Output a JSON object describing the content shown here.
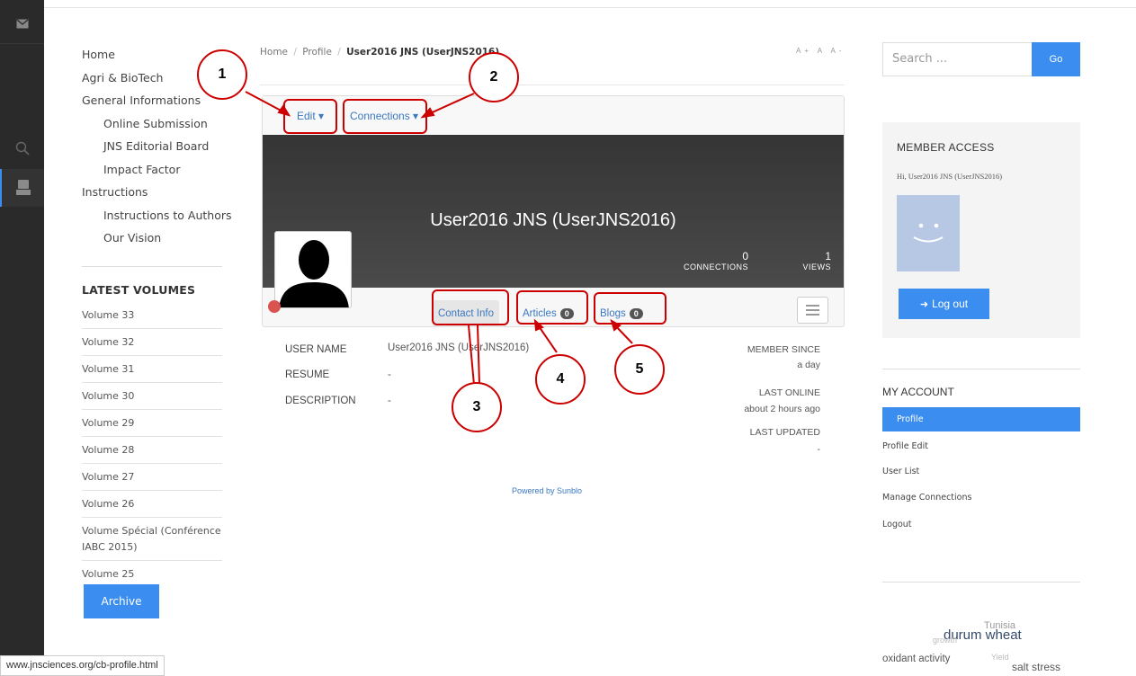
{
  "status_url": "www.jnsciences.org/cb-profile.html",
  "nav": {
    "items": [
      {
        "label": "Home",
        "level": 0
      },
      {
        "label": "Agri & BioTech",
        "level": 0
      },
      {
        "label": "General Informations",
        "level": 0
      },
      {
        "label": "Online Submission",
        "level": 1
      },
      {
        "label": "JNS Editorial Board",
        "level": 1
      },
      {
        "label": "Impact Factor",
        "level": 1
      },
      {
        "label": "Instructions",
        "level": 0
      },
      {
        "label": "Instructions to Authors",
        "level": 1
      },
      {
        "label": "Our Vision",
        "level": 1
      }
    ],
    "volumes_title": "LATEST VOLUMES",
    "volumes": [
      "Volume 33",
      "Volume 32",
      "Volume 31",
      "Volume 30",
      "Volume 29",
      "Volume 28",
      "Volume 27",
      "Volume 26",
      "Volume Spécial (Conférence IABC 2015)",
      "Volume 25"
    ],
    "archive_label": "Archive"
  },
  "breadcrumb": {
    "home": "Home",
    "sep": "/",
    "profile": "Profile",
    "current": "User2016 JNS (UserJNS2016)"
  },
  "font_controls": "A+ A A-",
  "profile": {
    "edit_label": "Edit ▾",
    "connections_label": "Connections ▾",
    "name": "User2016 JNS (UserJNS2016)",
    "connections_count": "0",
    "connections_label_stat": "CONNECTIONS",
    "views_count": "1",
    "views_label": "VIEWS",
    "tabs": {
      "contact": "Contact Info",
      "articles": "Articles",
      "articles_count": "0",
      "blogs": "Blogs",
      "blogs_count": "0"
    },
    "fields": {
      "username_label": "USER NAME",
      "username_value": "User2016 JNS (UserJNS2016)",
      "resume_label": "RESUME",
      "resume_value": "-",
      "description_label": "DESCRIPTION",
      "description_value": "-"
    },
    "meta": {
      "member_since_label": "MEMBER SINCE",
      "member_since_value": "a day",
      "last_online_label": "LAST ONLINE",
      "last_online_value": "about 2 hours ago",
      "last_updated_label": "LAST UPDATED",
      "last_updated_value": "-"
    },
    "powered": "Powered by Sunblo"
  },
  "search": {
    "placeholder": "Search ...",
    "go_label": "Go"
  },
  "member_access": {
    "title": "MEMBER ACCESS",
    "greeting": "Hi, User2016 JNS (UserJNS2016)",
    "logout_label": "Log out"
  },
  "account": {
    "title": "MY ACCOUNT",
    "items": [
      "Profile",
      "Profile Edit",
      "User List",
      "Manage Connections",
      "Logout"
    ]
  },
  "tags": [
    "Tunisia",
    "durum wheat",
    "growth",
    "oxidant activity",
    "Yield",
    "salt stress"
  ],
  "annotations": [
    "1",
    "2",
    "3",
    "4",
    "5"
  ],
  "colors": {
    "accent": "#3b8ef0",
    "annotation": "#cc0000",
    "sidebar": "#2a2a2a"
  }
}
